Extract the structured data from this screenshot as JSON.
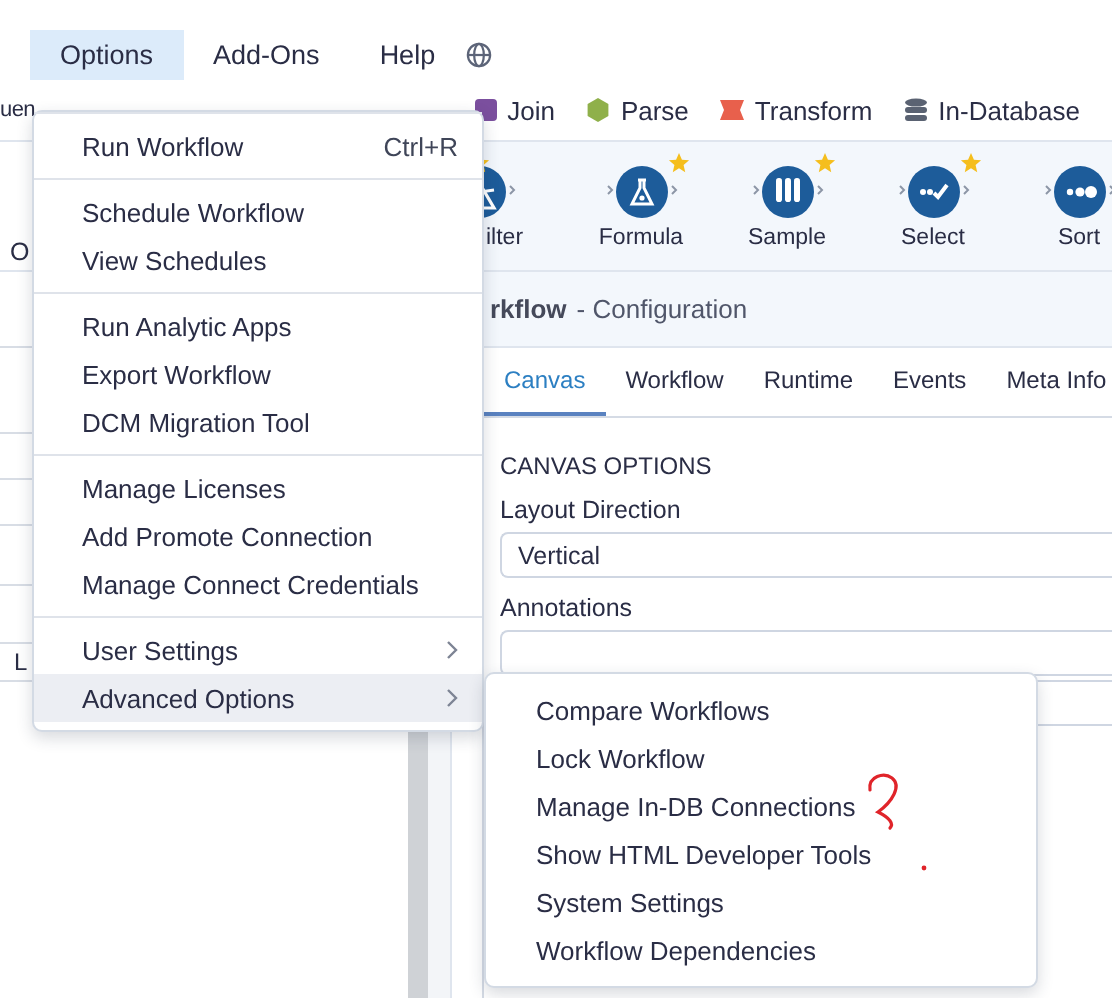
{
  "menubar": {
    "items": [
      {
        "label": "Options",
        "selected": true
      },
      {
        "label": "Add-Ons",
        "selected": false
      },
      {
        "label": "Help",
        "selected": false
      }
    ]
  },
  "ribbon": {
    "left_text": "uen",
    "categories": [
      {
        "label": "Join",
        "kind": "square",
        "color": "#7b4f9e"
      },
      {
        "label": "Parse",
        "kind": "hexagon",
        "color": "#8fb04a"
      },
      {
        "label": "Transform",
        "kind": "banner",
        "color": "#e8604c"
      },
      {
        "label": "In-Database",
        "kind": "database",
        "color": "#5a6272"
      }
    ]
  },
  "left_panel": {
    "top_label": "O",
    "row_label": "L"
  },
  "tools": [
    {
      "label": "ilter",
      "kind": "filter",
      "starred": true
    },
    {
      "label": "Formula",
      "kind": "formula",
      "starred": true
    },
    {
      "label": "Sample",
      "kind": "sample",
      "starred": true
    },
    {
      "label": "Select",
      "kind": "select",
      "starred": true
    },
    {
      "label": "Sort",
      "kind": "sort",
      "starred": false
    }
  ],
  "configuration": {
    "title": "rkflow",
    "subtitle": "- Configuration",
    "tabs": [
      {
        "label": "Canvas",
        "selected": true
      },
      {
        "label": "Workflow",
        "selected": false
      },
      {
        "label": "Runtime",
        "selected": false
      },
      {
        "label": "Events",
        "selected": false
      },
      {
        "label": "Meta Info",
        "selected": false
      }
    ],
    "section": "CANVAS OPTIONS",
    "fields": [
      {
        "label": "Layout Direction",
        "value": "Vertical"
      },
      {
        "label": "Annotations"
      }
    ]
  },
  "options_menu": {
    "groups": [
      [
        {
          "label": "Run Workflow",
          "shortcut": "Ctrl+R",
          "has_submenu": false,
          "selected": false
        }
      ],
      [
        {
          "label": "Schedule Workflow",
          "has_submenu": false,
          "selected": false
        },
        {
          "label": "View Schedules",
          "has_submenu": false,
          "selected": false
        }
      ],
      [
        {
          "label": "Run Analytic Apps",
          "has_submenu": false,
          "selected": false
        },
        {
          "label": "Export Workflow",
          "has_submenu": false,
          "selected": false
        },
        {
          "label": "DCM Migration Tool",
          "has_submenu": false,
          "selected": false
        }
      ],
      [
        {
          "label": "Manage Licenses",
          "has_submenu": false,
          "selected": false
        },
        {
          "label": "Add Promote Connection",
          "has_submenu": false,
          "selected": false
        },
        {
          "label": "Manage Connect Credentials",
          "has_submenu": false,
          "selected": false
        }
      ],
      [
        {
          "label": "User Settings",
          "has_submenu": true,
          "selected": false
        },
        {
          "label": "Advanced Options",
          "has_submenu": true,
          "selected": true
        }
      ]
    ]
  },
  "submenu": {
    "items": [
      {
        "label": "Compare Workflows"
      },
      {
        "label": "Lock Workflow"
      },
      {
        "label": "Manage In-DB Connections"
      },
      {
        "label": "Show HTML Developer Tools"
      },
      {
        "label": "System Settings"
      },
      {
        "label": "Workflow Dependencies"
      }
    ]
  }
}
